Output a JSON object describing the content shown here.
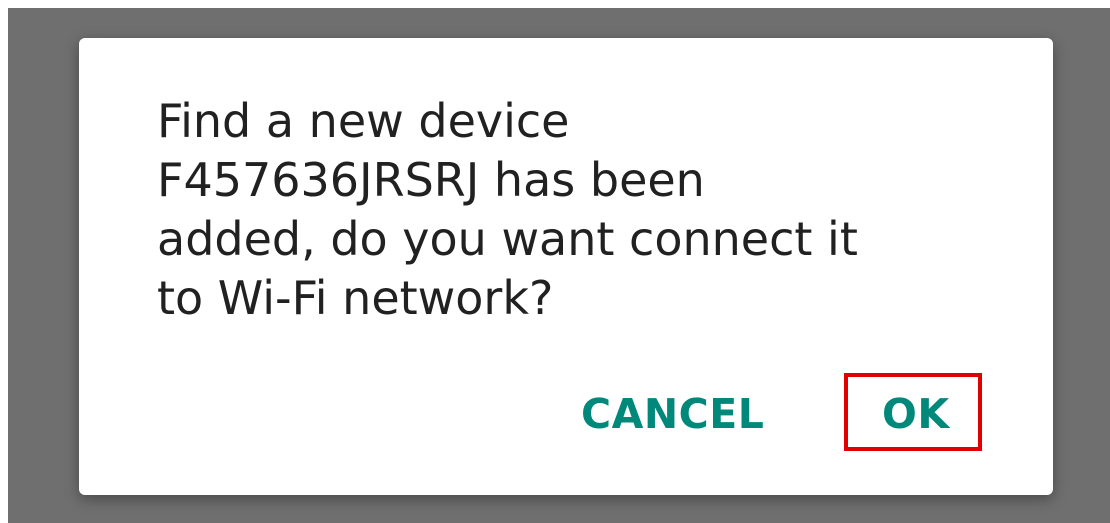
{
  "dialog": {
    "message": "Find a new device\nF457636JRSRJ has been\nadded, do you want connect it\nto Wi-Fi network?",
    "cancel_label": "CANCEL",
    "ok_label": "OK"
  },
  "colors": {
    "scrim": "#6f6f6f",
    "accent": "#00897b",
    "highlight_border": "#e00000",
    "text": "#212121"
  }
}
